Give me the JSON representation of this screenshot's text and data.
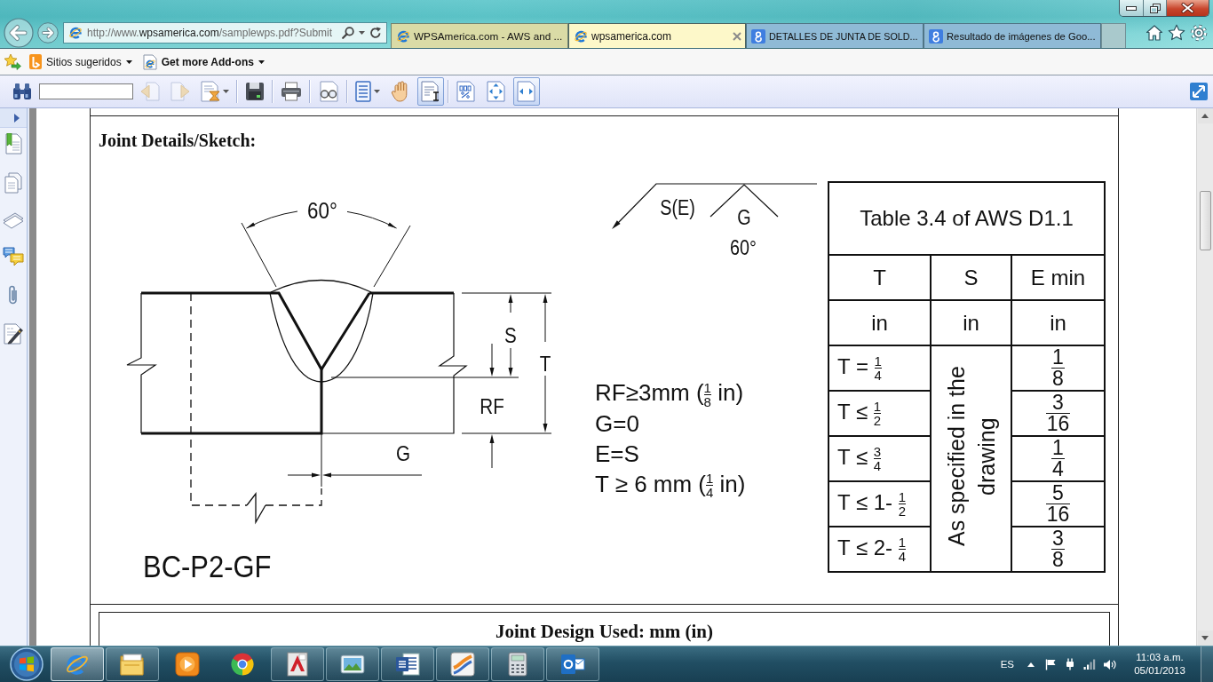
{
  "browser": {
    "address_bar": {
      "url_start": "http://www.",
      "url_domain": "wpsamerica.com",
      "url_end": "/samplewps.pdf?Submit"
    },
    "tabs": [
      {
        "title": "WPSAmerica.com - AWS and ...",
        "kind": "web",
        "color": "#dadba6",
        "selected": false
      },
      {
        "title": "wpsamerica.com",
        "kind": "web",
        "color": "#fdf8c9",
        "selected": true
      },
      {
        "title": "DETALLES DE JUNTA DE SOLD...",
        "kind": "search",
        "color": "#8fbad6",
        "selected": false
      },
      {
        "title": "Resultado de imágenes de Goo...",
        "kind": "search",
        "color": "#8fbad6",
        "selected": false
      }
    ],
    "favorites_bar": [
      {
        "label": "Sitios sugeridos",
        "kind": "suggested"
      },
      {
        "label": "Get more Add-ons",
        "kind": "addons"
      }
    ]
  },
  "pdf_toolbar": {
    "groups": [
      [
        {
          "kind": "find",
          "selected": false,
          "disabled": false,
          "dropdown": false
        },
        {
          "kind": "previous-page",
          "selected": false,
          "disabled": true,
          "dropdown": false
        },
        {
          "kind": "next-page",
          "selected": false,
          "disabled": true,
          "dropdown": false
        },
        {
          "kind": "page-progress",
          "selected": false,
          "disabled": false,
          "dropdown": true
        }
      ],
      [
        {
          "kind": "save",
          "selected": false,
          "disabled": false,
          "dropdown": false
        }
      ],
      [
        {
          "kind": "print",
          "selected": false,
          "disabled": false,
          "dropdown": false
        }
      ],
      [
        {
          "kind": "read-mode",
          "selected": false,
          "disabled": false,
          "dropdown": false
        }
      ],
      [
        {
          "kind": "page-display",
          "selected": false,
          "disabled": false,
          "dropdown": true
        },
        {
          "kind": "hand",
          "selected": false,
          "disabled": false,
          "dropdown": false
        },
        {
          "kind": "select-text",
          "selected": true,
          "disabled": false,
          "dropdown": false
        }
      ],
      [
        {
          "kind": "actual-size",
          "selected": false,
          "disabled": false,
          "dropdown": false
        },
        {
          "kind": "fit-page",
          "selected": false,
          "disabled": false,
          "dropdown": false
        },
        {
          "kind": "fit-width",
          "selected": true,
          "disabled": false,
          "dropdown": false
        }
      ]
    ]
  },
  "document": {
    "section_title": "Joint Details/Sketch:",
    "sketch": {
      "angle": "60°",
      "groove_depth": "S",
      "thickness": "T",
      "root_face": "RF",
      "root_opening": "G",
      "designation": "BC-P2-GF"
    },
    "weld_symbol": {
      "arrow_side": "S(E)",
      "groove": "G",
      "angle": "60°"
    },
    "notes": [
      {
        "prefix": "RF≥3mm (",
        "fraction": {
          "numerator": "1",
          "denominator": "8"
        },
        "suffix": " in)"
      },
      {
        "prefix": "G=0"
      },
      {
        "prefix": "E=S"
      },
      {
        "prefix": "T ≥ 6 mm (",
        "fraction": {
          "numerator": "1",
          "denominator": "4"
        },
        "suffix": " in)"
      }
    ],
    "table": {
      "title": "Table 3.4 of AWS D1.1",
      "columns": [
        "T",
        "S",
        "E min"
      ],
      "units": [
        "in",
        "in",
        "in"
      ],
      "s_value": "As specified in the drawing",
      "rows": [
        {
          "t": {
            "prefix": "T = ",
            "fraction": {
              "numerator": "1",
              "denominator": "4"
            }
          },
          "e_min": {
            "fraction": {
              "numerator": "1",
              "denominator": "8"
            }
          }
        },
        {
          "t": {
            "prefix": "T ≤ ",
            "fraction": {
              "numerator": "1",
              "denominator": "2"
            }
          },
          "e_min": {
            "fraction": {
              "numerator": "3",
              "denominator": "16"
            }
          }
        },
        {
          "t": {
            "prefix": "T ≤ ",
            "fraction": {
              "numerator": "3",
              "denominator": "4"
            }
          },
          "e_min": {
            "fraction": {
              "numerator": "1",
              "denominator": "4"
            }
          }
        },
        {
          "t": {
            "prefix": "T ≤ 1- ",
            "fraction": {
              "numerator": "1",
              "denominator": "2"
            }
          },
          "e_min": {
            "fraction": {
              "numerator": "5",
              "denominator": "16"
            }
          }
        },
        {
          "t": {
            "prefix": "T ≤ 2- ",
            "fraction": {
              "numerator": "1",
              "denominator": "4"
            }
          },
          "e_min": {
            "fraction": {
              "numerator": "3",
              "denominator": "8"
            }
          }
        }
      ]
    },
    "next_section_title": "Joint Design Used: mm (in)"
  },
  "taskbar": {
    "apps": [
      {
        "kind": "browser",
        "running": true,
        "selected": true
      },
      {
        "kind": "files",
        "running": true,
        "selected": false
      },
      {
        "kind": "media",
        "running": false,
        "selected": false
      },
      {
        "kind": "web",
        "running": false,
        "selected": false
      },
      {
        "kind": "cad",
        "running": true,
        "selected": false
      },
      {
        "kind": "photos",
        "running": true,
        "selected": false
      },
      {
        "kind": "writer",
        "running": true,
        "selected": false
      },
      {
        "kind": "stripes",
        "running": true,
        "selected": false
      },
      {
        "kind": "calculator",
        "running": true,
        "selected": false
      },
      {
        "kind": "mail",
        "running": true,
        "selected": false
      }
    ],
    "language": "ES",
    "time": "11:03 a.m.",
    "date": "05/01/2013"
  }
}
